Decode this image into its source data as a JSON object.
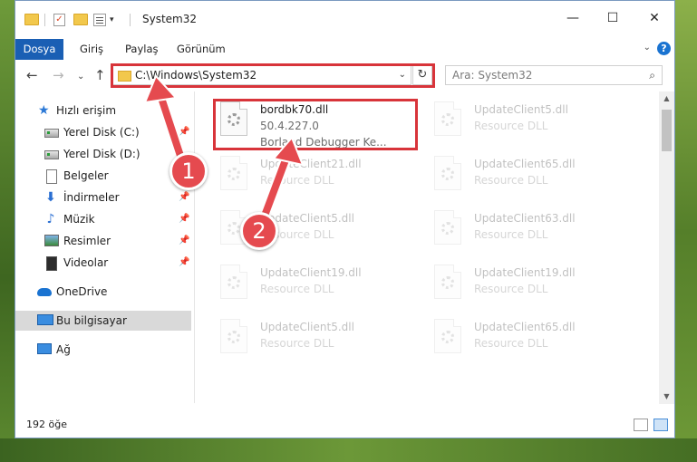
{
  "window": {
    "title": "System32"
  },
  "title_controls": {
    "minimize": "—",
    "maximize": "☐",
    "close": "✕"
  },
  "menu": {
    "file": "Dosya",
    "items": [
      "Giriş",
      "Paylaş",
      "Görünüm"
    ],
    "ribbon_toggle": "⌄",
    "help": "?"
  },
  "nav": {
    "back": "←",
    "forward": "→",
    "recent": "⌄",
    "up": "↑",
    "address": "C:\\Windows\\System32",
    "address_dropdown": "⌄",
    "refresh": "↻",
    "search_placeholder": "Ara: System32",
    "search_icon": "⌕"
  },
  "sidebar": {
    "items": [
      {
        "label": "Hızlı erişim",
        "icon": "star-icon",
        "glyph": "★"
      },
      {
        "label": "Yerel Disk (C:)",
        "icon": "disk-icon",
        "pinned": true
      },
      {
        "label": "Yerel Disk (D:)",
        "icon": "disk-icon"
      },
      {
        "label": "Belgeler",
        "icon": "document-icon"
      },
      {
        "label": "İndirmeler",
        "icon": "download-icon",
        "glyph": "⬇",
        "pinned": true
      },
      {
        "label": "Müzik",
        "icon": "music-icon",
        "glyph": "♪",
        "pinned": true
      },
      {
        "label": "Resimler",
        "icon": "pictures-icon",
        "pinned": true
      },
      {
        "label": "Videolar",
        "icon": "video-icon",
        "pinned": true
      },
      {
        "label": "OneDrive",
        "icon": "cloud-icon"
      },
      {
        "label": "Bu bilgisayar",
        "icon": "pc-icon",
        "selected": true
      },
      {
        "label": "Ağ",
        "icon": "network-icon"
      }
    ],
    "pin_glyph": "📌"
  },
  "files": {
    "highlighted": {
      "name": "bordbk70.dll",
      "version": "50.4.227.0",
      "description": "Borland Debugger Ke..."
    },
    "faded": [
      {
        "name": "UpdateClient5.dll",
        "type": "Resource DLL"
      },
      {
        "name": "UpdateClient21.dll",
        "type": "Resource DLL"
      },
      {
        "name": "UpdateClient65.dll",
        "type": "Resource DLL"
      },
      {
        "name": "UpdateClient5.dll",
        "type": "Resource DLL"
      },
      {
        "name": "UpdateClient63.dll",
        "type": "Resource DLL"
      },
      {
        "name": "UpdateClient19.dll",
        "type": "Resource DLL"
      },
      {
        "name": "UpdateClient19.dll",
        "type": "Resource DLL"
      },
      {
        "name": "UpdateClient5.dll",
        "type": "Resource DLL"
      },
      {
        "name": "UpdateClient65.dll",
        "type": "Resource DLL"
      }
    ]
  },
  "scroll": {
    "up": "▲",
    "down": "▼"
  },
  "status": {
    "item_count": "192 öğe"
  },
  "annotations": {
    "step1": "1",
    "step2": "2"
  },
  "colors": {
    "accent": "#1a5fb4",
    "highlight": "#d8343a",
    "callout": "#e54a4f"
  }
}
